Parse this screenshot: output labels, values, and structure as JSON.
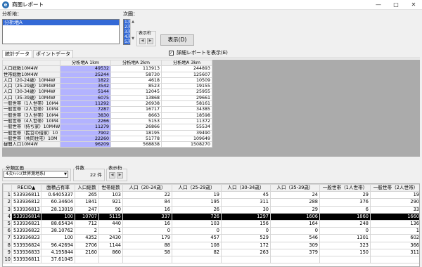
{
  "window": {
    "title": "商圏レポート"
  },
  "area": {
    "label": "分析地：",
    "items": [
      "分析地A"
    ]
  },
  "order": {
    "label": "次圏：",
    "items": [
      "1次",
      "2次",
      "3次",
      "4次",
      "5次"
    ]
  },
  "display": {
    "label": "表示桁",
    "button": "表示(D)"
  },
  "tabs": [
    "統計データ",
    "ポイントデータ"
  ],
  "detail_checkbox": {
    "label": "詳細レポートを表示(E)",
    "checked": true
  },
  "stats": {
    "columns": [
      "",
      "分析地A 1km",
      "分析地A 2km",
      "分析地A 3km"
    ],
    "rows": [
      [
        "人口総数10M4W",
        "49532",
        "113913",
        "244893"
      ],
      [
        "世帯総数10M4W",
        "25244",
        "58730",
        "125607"
      ],
      [
        "人口（20-24歳）10M4W",
        "1822",
        "4618",
        "10509"
      ],
      [
        "人口（25-29歳）10M4W",
        "3542",
        "8523",
        "19155"
      ],
      [
        "人口（30-34歳）10M4W",
        "5144",
        "12045",
        "25955"
      ],
      [
        "人口（35-39歳）10M4W",
        "6075",
        "13868",
        "29661"
      ],
      [
        "一般世帯（1人世帯）10M4",
        "11292",
        "26938",
        "58161"
      ],
      [
        "一般世帯（2人世帯）10M4",
        "7287",
        "16717",
        "34385"
      ],
      [
        "一般世帯（3人世帯）10M4",
        "3830",
        "8663",
        "18598"
      ],
      [
        "一般世帯（4人世帯）10M4",
        "2266",
        "5153",
        "11372"
      ],
      [
        "一般世帯（持ち家）10M4W",
        "11279",
        "26866",
        "55534"
      ],
      [
        "一般世帯（民営の借家）10",
        "7902",
        "18195",
        "39490"
      ],
      [
        "一般世帯（共同住宅）10M",
        "22260",
        "51778",
        "109649"
      ],
      [
        "昼間人口10M4W",
        "96209",
        "568838",
        "1508270"
      ]
    ]
  },
  "unit_select": {
    "label": "分類区画",
    "value": "4次ﾒｯｼｭ(世界測地系)"
  },
  "count": {
    "label": "件数",
    "value": "22 件"
  },
  "display2": {
    "label": "表示桁"
  },
  "points": {
    "columns": [
      "",
      "RECID▲",
      "面積占有率",
      "人口総数",
      "世帯総数",
      "人口（20-24歳）",
      "人口（25-29歳）",
      "人口（30-34歳）",
      "人口（35-39歳）",
      "一般世帯（1人世帯）",
      "一般世帯（2人世帯）"
    ],
    "rows": [
      [
        "1",
        "533936811",
        "0.6405337",
        "265",
        "103",
        "22",
        "19",
        "45",
        "24",
        "29",
        "19"
      ],
      [
        "2",
        "533936812",
        "60.34604",
        "1841",
        "921",
        "84",
        "195",
        "311",
        "288",
        "376",
        "290"
      ],
      [
        "3",
        "533936813",
        "28.13019",
        "247",
        "90",
        "16",
        "26",
        "30",
        "29",
        "6",
        "33"
      ],
      [
        "4",
        "533936814",
        "100",
        "10707",
        "5115",
        "337",
        "726",
        "1297",
        "1606",
        "1860",
        "1660"
      ],
      [
        "5",
        "533936821",
        "88.65434",
        "712",
        "440",
        "16",
        "103",
        "156",
        "164",
        "248",
        "136"
      ],
      [
        "6",
        "533936822",
        "38.10762",
        "2",
        "1",
        "0",
        "0",
        "0",
        "0",
        "0",
        "1"
      ],
      [
        "7",
        "533936823",
        "100",
        "4352",
        "2430",
        "179",
        "457",
        "529",
        "546",
        "1301",
        "602"
      ],
      [
        "8",
        "533936824",
        "96.42694",
        "2706",
        "1144",
        "88",
        "108",
        "172",
        "309",
        "323",
        "366"
      ],
      [
        "9",
        "533936833",
        "4.195844",
        "2160",
        "860",
        "58",
        "82",
        "263",
        "379",
        "150",
        "311"
      ],
      [
        "10",
        "533936811",
        "37.61045",
        "",
        "",
        "",
        "",
        "",
        "",
        "",
        ""
      ]
    ],
    "highlight_row": 3
  }
}
